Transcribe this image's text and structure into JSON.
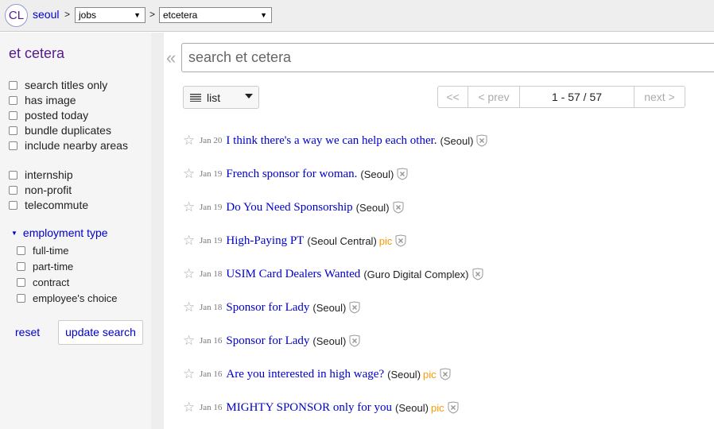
{
  "header": {
    "logo": "CL",
    "city": "seoul",
    "sep": ">",
    "category_select": "jobs",
    "subcategory_select": "etcetera"
  },
  "sidebar": {
    "title": "et cetera",
    "filters": [
      "search titles only",
      "has image",
      "posted today",
      "bundle duplicates",
      "include nearby areas"
    ],
    "job_filters": [
      "internship",
      "non-profit",
      "telecommute"
    ],
    "employment_type_label": "employment type",
    "employment_types": [
      "full-time",
      "part-time",
      "contract",
      "employee's choice"
    ],
    "reset_label": "reset",
    "update_label": "update search"
  },
  "search": {
    "placeholder": "search et cetera",
    "collapse_glyph": "«"
  },
  "view": {
    "selected": "list"
  },
  "pager": {
    "first": "<<",
    "prev": "< prev",
    "range": "1 - 57 / 57",
    "next": "next >"
  },
  "results": [
    {
      "date": "Jan 20",
      "title": "I think there's a way we can help each other.",
      "hood": "(Seoul)",
      "pic": ""
    },
    {
      "date": "Jan 19",
      "title": "French sponsor for woman.",
      "hood": "(Seoul)",
      "pic": ""
    },
    {
      "date": "Jan 19",
      "title": "Do You Need Sponsorship",
      "hood": "(Seoul)",
      "pic": ""
    },
    {
      "date": "Jan 19",
      "title": "High-Paying PT",
      "hood": "(Seoul Central)",
      "pic": "pic"
    },
    {
      "date": "Jan 18",
      "title": "USIM Card Dealers Wanted",
      "hood": "(Guro Digital Complex)",
      "pic": ""
    },
    {
      "date": "Jan 18",
      "title": "Sponsor for Lady",
      "hood": "(Seoul)",
      "pic": ""
    },
    {
      "date": "Jan 16",
      "title": "Sponsor for Lady",
      "hood": "(Seoul)",
      "pic": ""
    },
    {
      "date": "Jan 16",
      "title": "Are you interested in high wage?",
      "hood": "(Seoul)",
      "pic": "pic"
    },
    {
      "date": "Jan 16",
      "title": "MIGHTY SPONSOR only for you",
      "hood": "(Seoul)",
      "pic": "pic"
    }
  ],
  "colors": {
    "link": "#0000cc",
    "visited": "#551a8b",
    "pic": "#ff9900"
  }
}
